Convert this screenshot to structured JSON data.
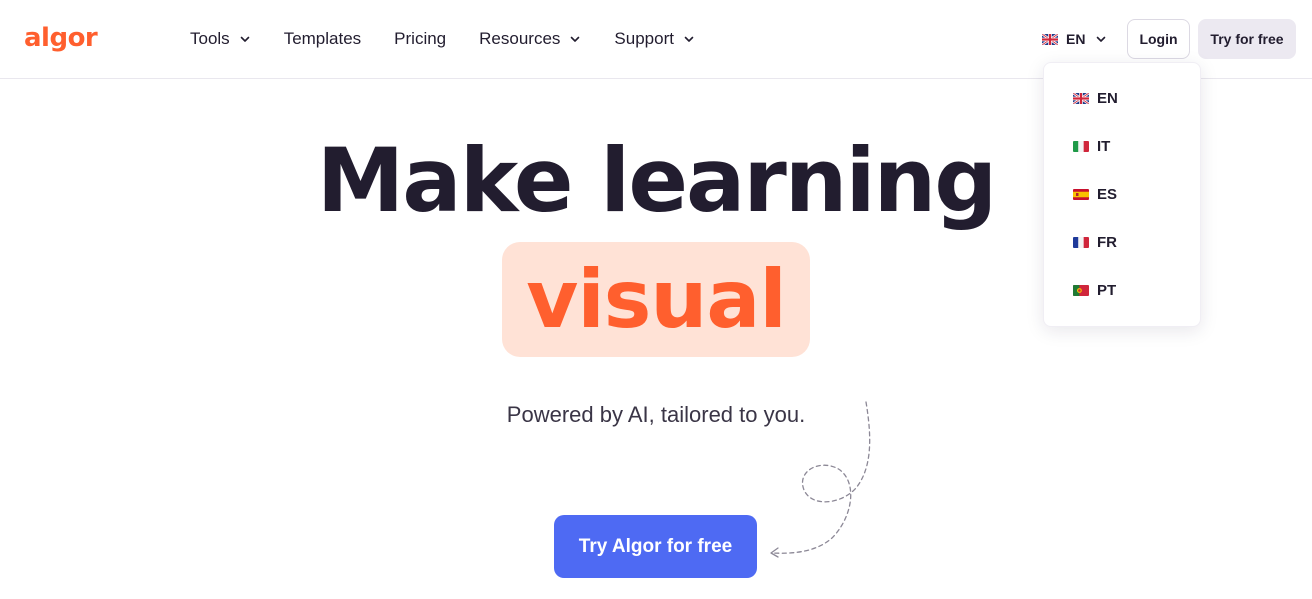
{
  "brand": {
    "name": "algor",
    "color": "#ff5f2e"
  },
  "nav": {
    "items": [
      {
        "label": "Tools",
        "has_dropdown": true
      },
      {
        "label": "Templates",
        "has_dropdown": false
      },
      {
        "label": "Pricing",
        "has_dropdown": false
      },
      {
        "label": "Resources",
        "has_dropdown": true
      },
      {
        "label": "Support",
        "has_dropdown": true
      }
    ]
  },
  "language": {
    "current": "EN",
    "current_flag": "uk-flag-icon",
    "options": [
      {
        "code": "EN",
        "flag": "uk-flag-icon"
      },
      {
        "code": "IT",
        "flag": "italy-flag-icon"
      },
      {
        "code": "ES",
        "flag": "spain-flag-icon"
      },
      {
        "code": "FR",
        "flag": "france-flag-icon"
      },
      {
        "code": "PT",
        "flag": "portugal-flag-icon"
      }
    ]
  },
  "header": {
    "login_label": "Login",
    "try_label": "Try for free"
  },
  "hero": {
    "title": "Make learning",
    "highlight": "visual",
    "subtitle": "Powered by AI, tailored to you.",
    "cta_label": "Try Algor for free"
  },
  "colors": {
    "accent": "#ff5f2e",
    "pill_bg": "#ffe2d6",
    "cta": "#4e6af3",
    "text": "#221d2f"
  }
}
